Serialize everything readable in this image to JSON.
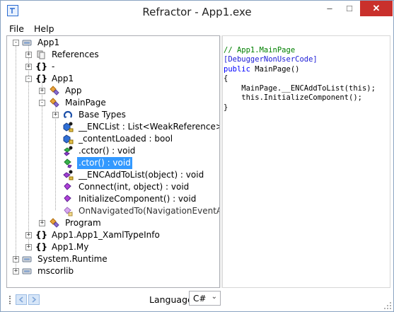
{
  "window": {
    "title": "Refractor - App1.exe"
  },
  "menu": {
    "file": "File",
    "help": "Help"
  },
  "tree": {
    "app1_root": "App1",
    "references": "References",
    "dash_ns": "-",
    "app1_ns": "App1",
    "app_class": "App",
    "mainpage_class": "MainPage",
    "base_types": "Base Types",
    "enclist": "__ENCList : List<WeakReference>",
    "content_loaded": "_contentLoaded : bool",
    "cctor": ".cctor() : void",
    "ctor": ".ctor() : void",
    "encaddtolist": "__ENCAddToList(object) : void",
    "connect": "Connect(int, object) : void",
    "initcomp": "InitializeComponent() : void",
    "onnavigated": "OnNavigatedTo(NavigationEventArgs",
    "program_class": "Program",
    "xamltypeinfo_ns": "App1.App1_XamlTypeInfo",
    "my_ns": "App1.My",
    "system_runtime": "System.Runtime",
    "mscorlib": "mscorlib"
  },
  "code": {
    "line1": "// App1.MainPage",
    "line2": "[DebuggerNonUserCode]",
    "line3_kw": "public",
    "line3_rest": " MainPage()",
    "line4": "{",
    "line5": "    MainPage.__ENCAddToList(this);",
    "line6": "    this.InitializeComponent();",
    "line7": "}"
  },
  "bottom": {
    "language_label": "Language:",
    "language_value": "C#"
  },
  "colors": {
    "selection": "#3399ff",
    "comment": "#008000",
    "keyword": "#0000ff",
    "close_button": "#c9302c"
  }
}
